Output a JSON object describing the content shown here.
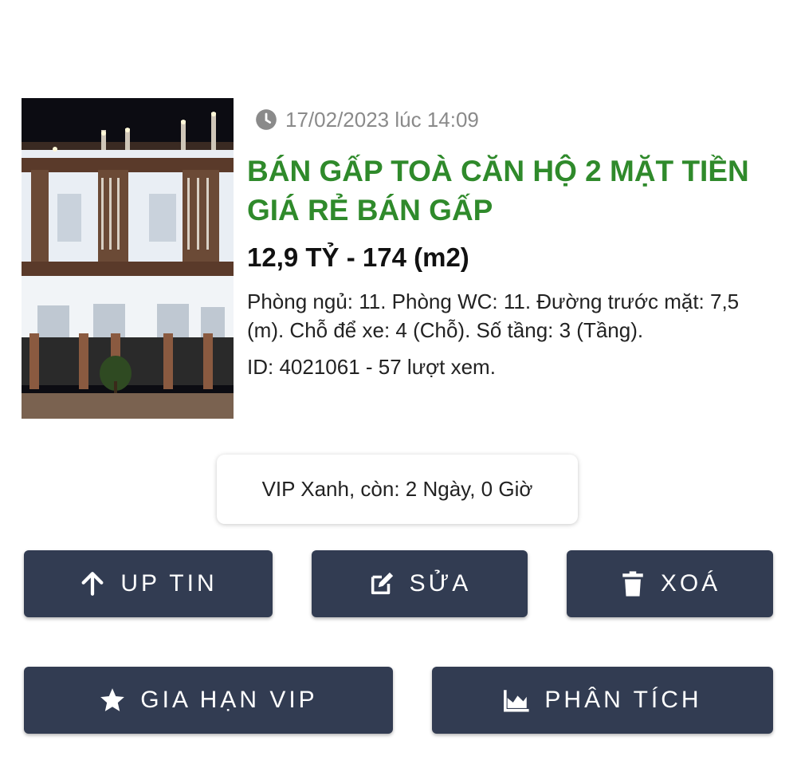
{
  "listing": {
    "datetime": "17/02/2023 lúc 14:09",
    "title": "BÁN GẤP TOÀ CĂN HỘ 2 MẶT TIỀN GIÁ RẺ BÁN GẤP",
    "price_area": "12,9 TỶ - 174 (m2)",
    "details": "Phòng ngủ: 11. Phòng WC: 11. Đường trước mặt: 7,5 (m). Chỗ để xe: 4 (Chỗ). Số tầng: 3 (Tầng).",
    "id_views": "ID: 4021061 - 57 lượt xem."
  },
  "vip_status": "VIP Xanh, còn: 2 Ngày, 0 Giờ",
  "actions": {
    "up": "UP TIN",
    "edit": "SỬA",
    "delete": "XOÁ",
    "extend_vip": "GIA HẠN VIP",
    "analytics": "PHÂN TÍCH"
  },
  "icons": {
    "time": "clock-icon",
    "up": "arrow-up-icon",
    "edit": "edit-icon",
    "delete": "trash-icon",
    "extend_vip": "star-icon",
    "analytics": "area-chart-icon"
  },
  "colors": {
    "title": "#2f8a2b",
    "button_bg": "#323c52",
    "muted_text": "#8a8a8a"
  }
}
